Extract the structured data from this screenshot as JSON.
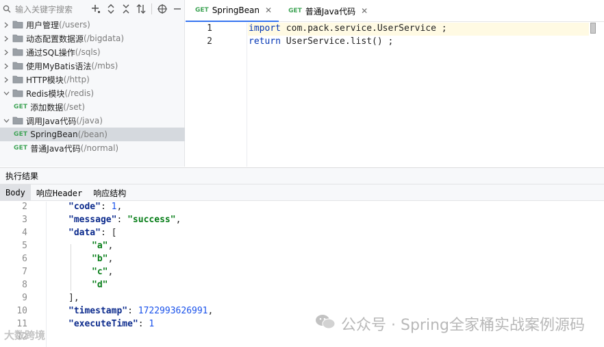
{
  "search": {
    "placeholder": "输入关键字搜索"
  },
  "tree": {
    "items": [
      {
        "label": "用户管理",
        "path": "(/users)"
      },
      {
        "label": "动态配置数据源",
        "path": "(/bigdata)"
      },
      {
        "label": "通过SQL操作",
        "path": "(/sqls)"
      },
      {
        "label": "使用MyBatis语法",
        "path": "(/mbs)"
      },
      {
        "label": "HTTP模块",
        "path": "(/http)"
      },
      {
        "label": "Redis模块",
        "path": "(/redis)"
      },
      {
        "method": "GET",
        "label": "添加数据",
        "path": "(/set)"
      },
      {
        "label": "调用Java代码",
        "path": "(/java)"
      },
      {
        "method": "GET",
        "label": "SpringBean",
        "path": "(/bean)"
      },
      {
        "method": "GET",
        "label": "普通Java代码",
        "path": "(/normal)"
      }
    ]
  },
  "tabs": [
    {
      "method": "GET",
      "label": "SpringBean"
    },
    {
      "method": "GET",
      "label": "普通Java代码"
    }
  ],
  "editor": {
    "lines": [
      {
        "num": "1",
        "kw": "import",
        "rest": " com.pack.service.UserService ;"
      },
      {
        "num": "2",
        "kw": "return",
        "rest": " UserService.list() ;"
      }
    ]
  },
  "results": {
    "title": "执行结果",
    "tabs": [
      "Body",
      "响应Header",
      "响应结构"
    ],
    "line_numbers": [
      "2",
      "3",
      "4",
      "5",
      "6",
      "7",
      "8",
      "9",
      "10",
      "11",
      "12"
    ],
    "json": {
      "code_key": "\"code\"",
      "code_val": "1",
      "message_key": "\"message\"",
      "message_val": "\"success\"",
      "data_key": "\"data\"",
      "data_items": [
        "\"a\"",
        "\"b\"",
        "\"c\"",
        "\"d\""
      ],
      "timestamp_key": "\"timestamp\"",
      "timestamp_val": "1722993626991",
      "execute_key": "\"executeTime\"",
      "execute_val": "1"
    }
  },
  "watermark": {
    "right": "公众号 · Spring全家桶实战案例源码",
    "left": "大数跨境"
  }
}
